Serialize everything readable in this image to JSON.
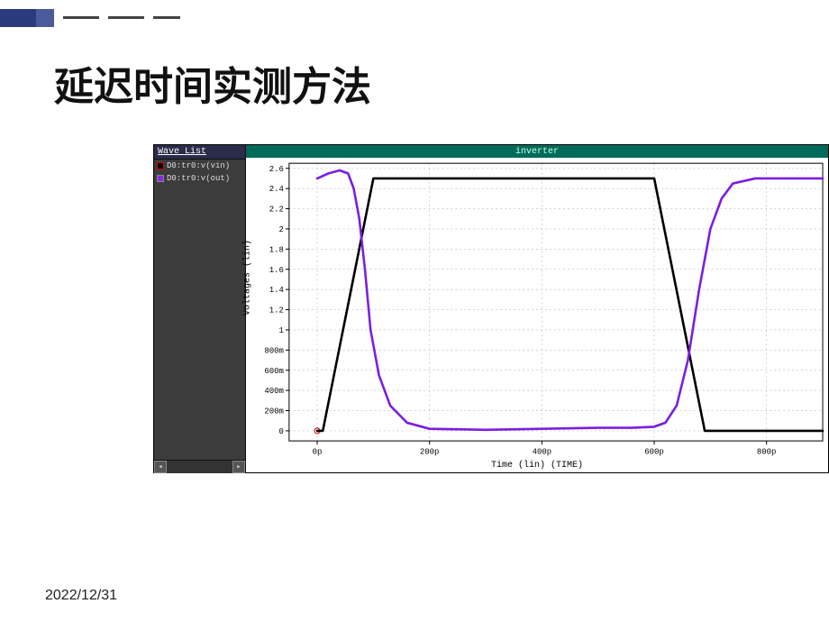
{
  "title": "延迟时间实测方法",
  "footer": {
    "date": "2022/12/31"
  },
  "wave_list": {
    "title": "Wave List",
    "items": [
      {
        "label": "D0:tr0:v(vin)",
        "color": "#000000"
      },
      {
        "label": "D0:tr0:v(out)",
        "color": "#7a1fe0"
      }
    ]
  },
  "chart_data": {
    "type": "line",
    "title": "inverter",
    "xlabel": "Time (lin) (TIME)",
    "ylabel": "Voltages (lin)",
    "x_unit": "p",
    "xlim": [
      -50,
      900
    ],
    "ylim": [
      -0.1,
      2.65
    ],
    "x_ticks": [
      0,
      200,
      400,
      600,
      800
    ],
    "y_ticks": [
      0,
      0.2,
      0.4,
      0.6,
      0.8,
      1.0,
      1.2,
      1.4,
      1.6,
      1.8,
      2.0,
      2.2,
      2.4,
      2.6
    ],
    "y_tick_labels": [
      "0",
      "200m",
      "400m",
      "600m",
      "800m",
      "1",
      "1.2",
      "1.4",
      "1.6",
      "1.8",
      "2",
      "2.2",
      "2.4",
      "2.6"
    ],
    "series": [
      {
        "name": "v(vin)",
        "color": "#000000",
        "x": [
          0,
          10,
          100,
          600,
          690,
          900
        ],
        "y": [
          0,
          0.0,
          2.5,
          2.5,
          0.0,
          0.0
        ]
      },
      {
        "name": "v(out)",
        "color": "#7a1fe0",
        "x": [
          0,
          20,
          40,
          55,
          65,
          75,
          85,
          95,
          110,
          130,
          160,
          200,
          300,
          400,
          500,
          560,
          600,
          620,
          640,
          660,
          680,
          700,
          720,
          740,
          780,
          840,
          900
        ],
        "y": [
          2.5,
          2.55,
          2.58,
          2.55,
          2.4,
          2.1,
          1.6,
          1.0,
          0.55,
          0.25,
          0.08,
          0.02,
          0.01,
          0.02,
          0.03,
          0.03,
          0.04,
          0.08,
          0.25,
          0.7,
          1.4,
          2.0,
          2.3,
          2.45,
          2.5,
          2.5,
          2.5
        ]
      }
    ]
  }
}
